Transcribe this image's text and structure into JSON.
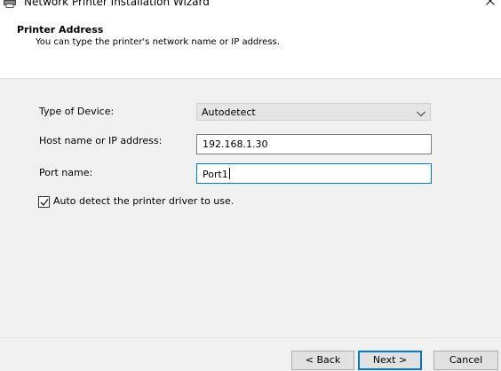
{
  "window": {
    "title": "Network Printer Installation Wizard",
    "icon": "printer-icon",
    "close_icon": "close-icon"
  },
  "header": {
    "title": "Printer Address",
    "subtitle": "You can type the printer's network name or IP address."
  },
  "form": {
    "device_type": {
      "label": "Type of Device:",
      "selected": "Autodetect"
    },
    "host": {
      "label": "Host name or IP address:",
      "value": "192.168.1.30"
    },
    "port": {
      "label": "Port name:",
      "value": "Port1"
    },
    "auto_detect": {
      "label": "Auto detect the printer driver to use.",
      "checked": true
    }
  },
  "buttons": {
    "back": "< Back",
    "next": "Next >",
    "cancel": "Cancel"
  },
  "colors": {
    "focus_accent": "#0078d7"
  }
}
